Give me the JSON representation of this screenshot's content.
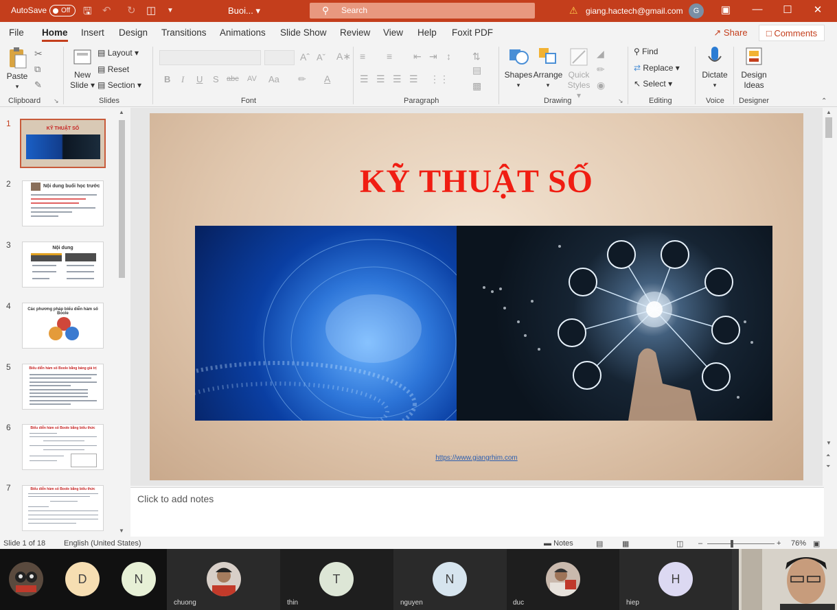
{
  "titlebar": {
    "autosave_label": "AutoSave",
    "autosave_state": "Off",
    "doc_title": "Buoi...",
    "search_placeholder": "Search",
    "account_email": "giang.hactech@gmail.com",
    "account_initial": "G"
  },
  "menu": {
    "tabs": [
      "File",
      "Home",
      "Insert",
      "Design",
      "Transitions",
      "Animations",
      "Slide Show",
      "Review",
      "View",
      "Help",
      "Foxit PDF"
    ],
    "active_tab": "Home",
    "share_label": "Share",
    "comments_label": "Comments"
  },
  "ribbon": {
    "clipboard": {
      "paste": "Paste",
      "label": "Clipboard"
    },
    "slides": {
      "new_slide_line1": "New",
      "new_slide_line2": "Slide",
      "layout": "Layout",
      "reset": "Reset",
      "section": "Section",
      "label": "Slides"
    },
    "font": {
      "bold": "B",
      "italic": "I",
      "underline": "U",
      "strike": "S",
      "abc": "abc",
      "av": "AV",
      "aa": "Aa",
      "label": "Font"
    },
    "paragraph": {
      "label": "Paragraph"
    },
    "drawing": {
      "shapes": "Shapes",
      "arrange": "Arrange",
      "quick_styles_line1": "Quick",
      "quick_styles_line2": "Styles",
      "label": "Drawing"
    },
    "editing": {
      "find": "Find",
      "replace": "Replace",
      "select": "Select",
      "label": "Editing"
    },
    "voice": {
      "dictate": "Dictate",
      "label": "Voice"
    },
    "designer": {
      "design_ideas_line1": "Design",
      "design_ideas_line2": "Ideas",
      "label": "Designer"
    }
  },
  "slides_pane": {
    "numbers": [
      "1",
      "2",
      "3",
      "4",
      "5",
      "6",
      "7"
    ],
    "thumb1_title": "KỸ THUẬT SỐ",
    "thumb2_title": "Nội dung buổi học trước",
    "thumb3_title": "Nội dung",
    "thumb4_title": "Các phương pháp biểu diễn hàm số Boole",
    "thumb5_title": "Biểu diễn hàm số Boole bằng bảng giá trị",
    "thumb6_title": "Biểu diễn hàm số Boole bằng biểu thức",
    "thumb7_title": "Biểu diễn hàm số Boole bằng biểu thức"
  },
  "slide": {
    "title": "KỸ THUẬT SỐ",
    "link": "https://www.giangrhim.com"
  },
  "notes_placeholder": "Click to add notes",
  "status": {
    "slide_info": "Slide 1 of 18",
    "language": "English (United States)",
    "notes": "Notes",
    "zoom": "76%"
  },
  "participants": [
    {
      "name": "",
      "initial": ""
    },
    {
      "name": "",
      "initial": "D"
    },
    {
      "name": "",
      "initial": "N"
    },
    {
      "name": "chuong",
      "initial": ""
    },
    {
      "name": "thin",
      "initial": "T"
    },
    {
      "name": "nguyen",
      "initial": "N"
    },
    {
      "name": "duc",
      "initial": ""
    },
    {
      "name": "hiep",
      "initial": "H"
    },
    {
      "name": "",
      "initial": ""
    }
  ],
  "colors": {
    "accent": "#c43e1c",
    "slide_title": "#f01d12"
  }
}
